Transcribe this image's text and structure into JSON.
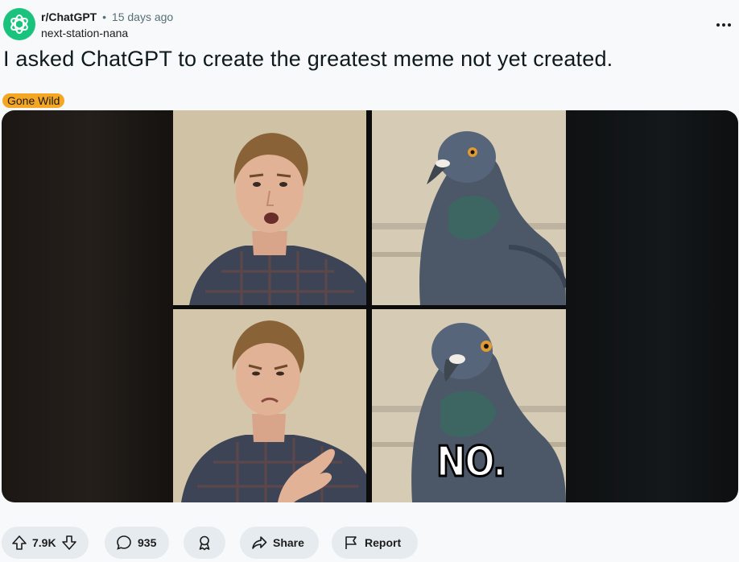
{
  "post": {
    "subreddit": "r/ChatGPT",
    "separator": "•",
    "time": "15 days ago",
    "author": "next-station-nana",
    "title": "I asked ChatGPT to create the greatest meme not yet created.",
    "flair": "Gone Wild",
    "flair_color": "#f5a623"
  },
  "media": {
    "caption": "NO."
  },
  "actions": {
    "score": "7.9K",
    "comments": "935",
    "share": "Share",
    "report": "Report"
  },
  "icons": {
    "avatar": "openai-logo-icon",
    "more": "more-horizontal-icon",
    "upvote": "arrow-up-icon",
    "downvote": "arrow-down-icon",
    "comment": "speech-bubble-icon",
    "award": "award-icon",
    "share": "share-arrow-icon",
    "report": "flag-icon"
  }
}
